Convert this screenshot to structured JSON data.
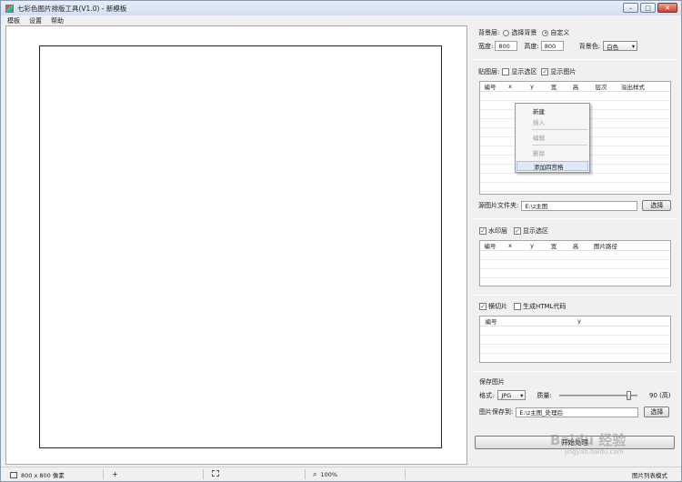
{
  "window": {
    "title": "七彩色图片排版工具(V1.0) - 新模板",
    "controls": {
      "minimize": "–",
      "maximize": "□",
      "close": "✕"
    }
  },
  "menu": [
    "模板",
    "设置",
    "帮助"
  ],
  "background": {
    "label": "背景层:",
    "options": [
      "选择背景",
      "自定义"
    ],
    "selected": "自定义",
    "width_label": "宽度:",
    "width_value": "800",
    "height_label": "高度:",
    "height_value": "800",
    "color_label": "背景色:",
    "color_value": "白色"
  },
  "paste_layer": {
    "label": "贴图层:",
    "show_selection": {
      "label": "显示选区",
      "checked": false
    },
    "show_image": {
      "label": "显示图片",
      "checked": true
    },
    "columns": [
      "编号",
      "x",
      "y",
      "宽",
      "高",
      "层次",
      "溢出样式"
    ]
  },
  "context_menu": {
    "items": [
      {
        "label": "新建",
        "enabled": true
      },
      {
        "label": "插入",
        "enabled": false
      },
      {
        "label": "编辑",
        "enabled": false
      },
      {
        "label": "删除",
        "enabled": false
      },
      {
        "label": "添加四宫格",
        "enabled": true,
        "highlighted": true
      }
    ]
  },
  "source_folder": {
    "label": "源图片文件夹:",
    "value": "E:\\z主图",
    "button": "选择"
  },
  "watermark_layer": {
    "enabled": {
      "label": "水印层",
      "checked": true
    },
    "show_selection": {
      "label": "显示选区",
      "checked": true
    },
    "columns": [
      "编号",
      "x",
      "y",
      "宽",
      "高",
      "图片路径"
    ]
  },
  "slice": {
    "enabled": {
      "label": "横切片",
      "checked": true
    },
    "html": {
      "label": "生成HTML代码",
      "checked": false
    },
    "columns": [
      "编号",
      "y"
    ]
  },
  "save": {
    "section_label": "保存图片",
    "format_label": "格式:",
    "format_value": "JPG",
    "quality_label": "质量:",
    "quality_value": 90,
    "quality_text": "90 (高)",
    "save_to_label": "图片保存到:",
    "save_to_value": "E:\\z主图_处理后",
    "button": "选择",
    "start_button": "开始处理"
  },
  "status": {
    "size": "800 x 800 像素",
    "zoom": "100%",
    "mode": "图片列表模式"
  },
  "watermark_text": {
    "main": "Baidu 经验",
    "sub": "jingyan.baidu.com"
  }
}
